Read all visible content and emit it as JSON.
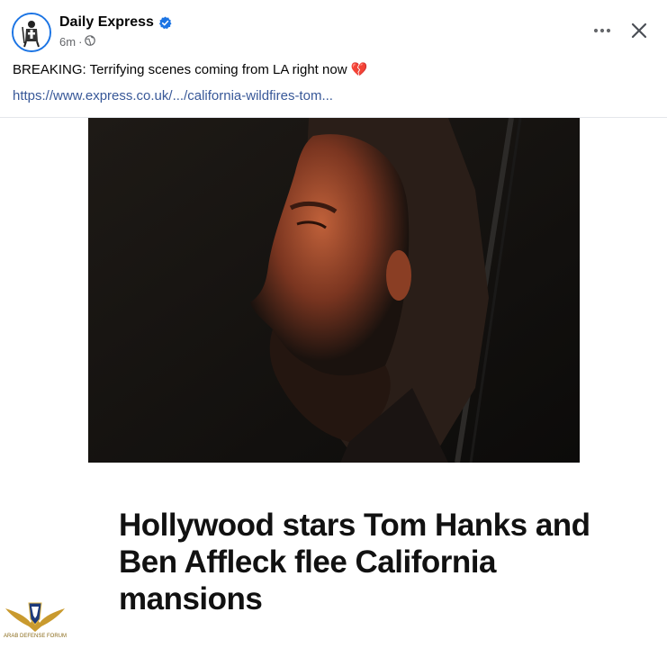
{
  "post": {
    "page_name": "Daily Express",
    "time": "6m",
    "privacy_icon": "globe-icon",
    "caption": "BREAKING: Terrifying scenes coming from LA right now 💔",
    "link": "https://www.express.co.uk/.../california-wildfires-tom...",
    "headline": "Hollywood stars Tom Hanks and Ben Affleck flee California mansions"
  },
  "icons": {
    "more": "more-options-icon",
    "close": "close-icon",
    "verified": "verified-badge-icon"
  },
  "watermark": {
    "text_en": "ARAB DEFENSE FORUM"
  },
  "colors": {
    "verified": "#1b74e4",
    "link": "#385898",
    "text": "#050505",
    "meta": "#65676b"
  }
}
